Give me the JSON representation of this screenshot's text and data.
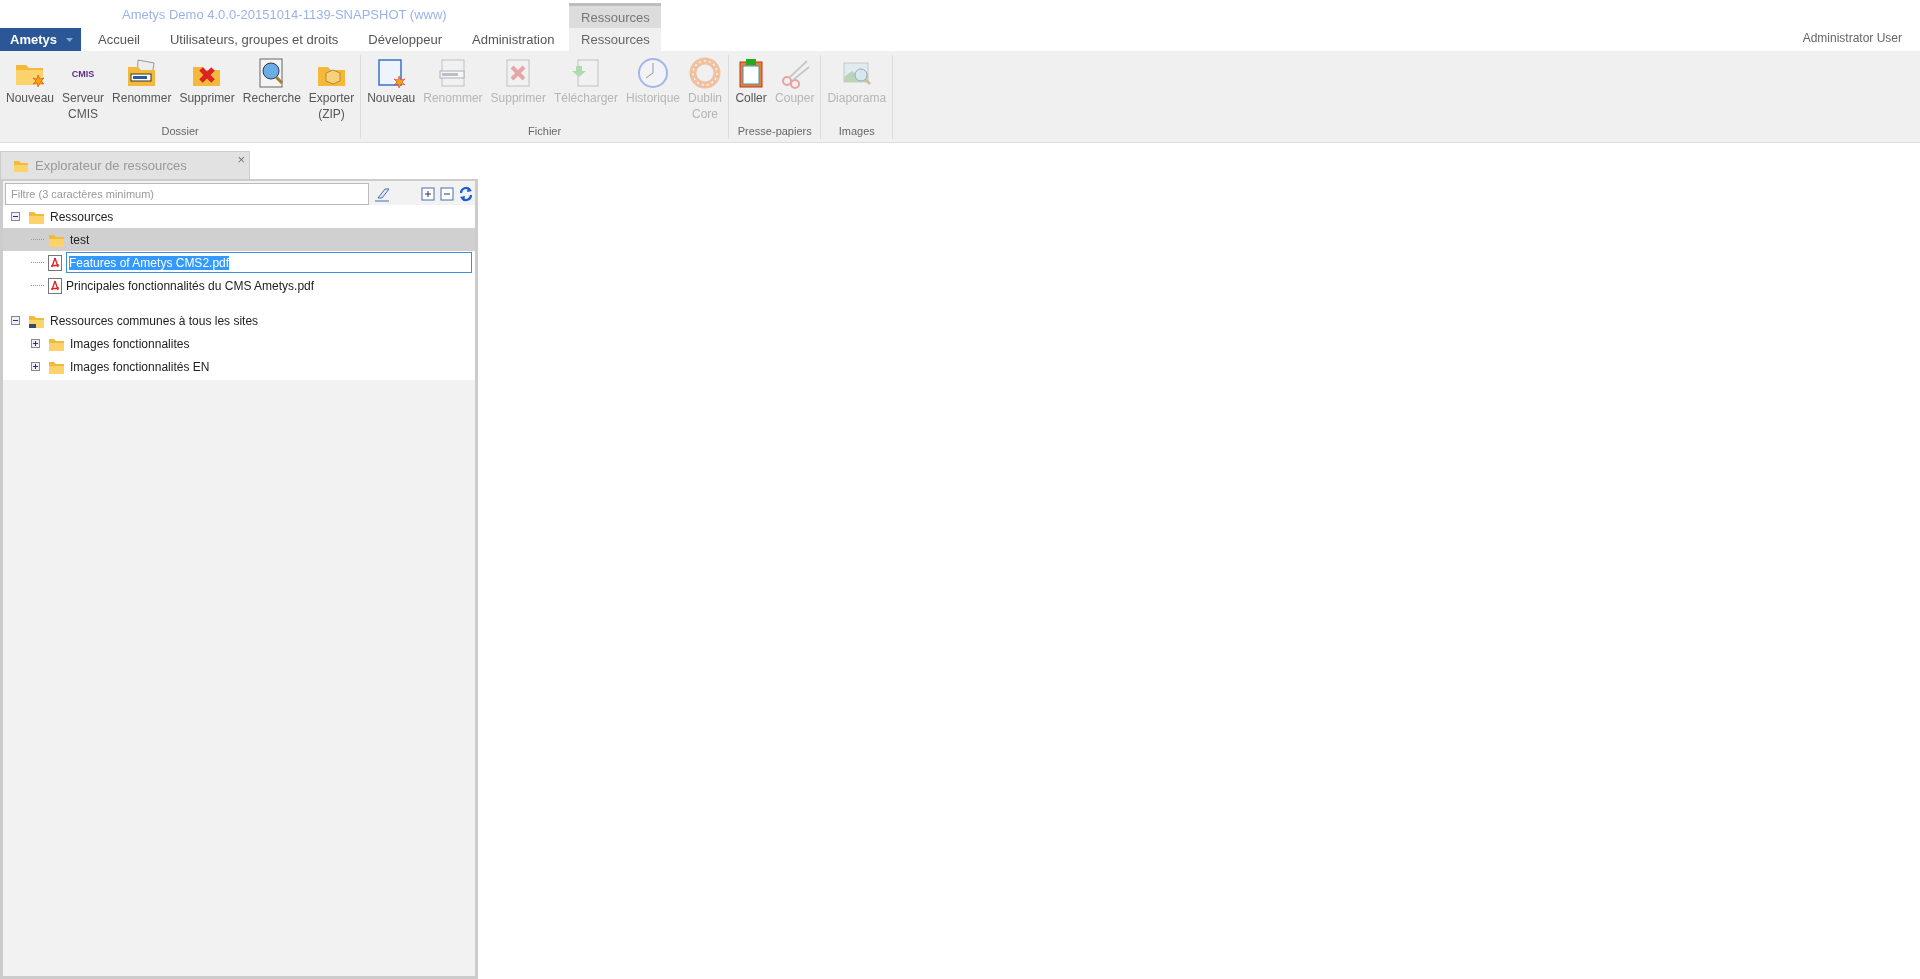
{
  "app_title": "Ametys Demo 4.0.0-20151014-1139-SNAPSHOT (www)",
  "app_menu": {
    "label": "Ametys"
  },
  "tabs": [
    {
      "label": "Accueil",
      "selected": false
    },
    {
      "label": "Utilisateurs, groupes et droits",
      "selected": false
    },
    {
      "label": "Développeur",
      "selected": false
    },
    {
      "label": "Administration",
      "selected": false
    }
  ],
  "context_group": {
    "label": "Ressources",
    "tabs": [
      {
        "label": "Ressources",
        "selected": true
      }
    ]
  },
  "user": "Administrator User",
  "ribbon": {
    "groups": [
      {
        "label": "Dossier",
        "buttons": [
          {
            "label": "Nouveau",
            "disabled": false
          },
          {
            "label": "Serveur\nCMIS",
            "disabled": false,
            "icon_text": "CMIS"
          },
          {
            "label": "Renommer",
            "disabled": false
          },
          {
            "label": "Supprimer",
            "disabled": false
          },
          {
            "label": "Recherche",
            "disabled": false
          },
          {
            "label": "Exporter\n(ZIP)",
            "disabled": false
          }
        ]
      },
      {
        "label": "Fichier",
        "buttons": [
          {
            "label": "Nouveau",
            "disabled": false
          },
          {
            "label": "Renommer",
            "disabled": true
          },
          {
            "label": "Supprimer",
            "disabled": true
          },
          {
            "label": "Télécharger",
            "disabled": true
          },
          {
            "label": "Historique",
            "disabled": true
          },
          {
            "label": "Dublin\nCore",
            "disabled": true
          }
        ]
      },
      {
        "label": "Presse-papiers",
        "buttons": [
          {
            "label": "Coller",
            "disabled": false
          },
          {
            "label": "Couper",
            "disabled": true
          }
        ]
      },
      {
        "label": "Images",
        "buttons": [
          {
            "label": "Diaporama",
            "disabled": true
          }
        ]
      }
    ]
  },
  "panel": {
    "title": "Explorateur de ressources",
    "close": "×",
    "filter": {
      "placeholder": "Filtre (3 caractères minimum)"
    },
    "tree": [
      {
        "label": "Ressources",
        "kind": "root",
        "expanded": true,
        "selected": false,
        "editing": false,
        "children": [
          {
            "label": "test",
            "kind": "folder",
            "selected": true,
            "editing": false
          },
          {
            "label": "Features of Ametys CMS2.pdf",
            "kind": "pdf",
            "selected": false,
            "editing": true
          },
          {
            "label": "Principales fonctionnalités du CMS Ametys.pdf",
            "kind": "pdf",
            "selected": false,
            "editing": false
          }
        ]
      },
      {
        "label": "Ressources communes à tous les sites",
        "kind": "shared-root",
        "expanded": true,
        "selected": false,
        "editing": false,
        "children": [
          {
            "label": "Images fonctionnalites",
            "kind": "folder",
            "expanded": false,
            "selected": false,
            "editing": false
          },
          {
            "label": "Images fonctionnalités EN",
            "kind": "folder",
            "expanded": false,
            "selected": false,
            "editing": false
          }
        ]
      }
    ]
  }
}
